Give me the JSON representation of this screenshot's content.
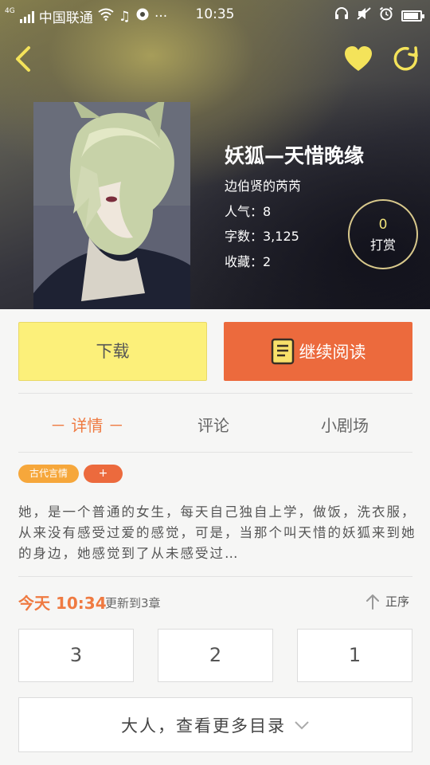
{
  "status_bar": {
    "network": "4G",
    "carrier": "中国联通",
    "time": "10:35"
  },
  "nav": {
    "back_icon": "chevron-left-icon",
    "favorite_icon": "heart-icon",
    "share_icon": "refresh-icon"
  },
  "book": {
    "title": "妖狐—天惜晚缘",
    "author": "边伯贤的芮芮",
    "popularity": "人气：8",
    "word_count": "字数：3,125",
    "favorites": "收藏：2"
  },
  "reward": {
    "count": "0",
    "label": "打赏"
  },
  "actions": {
    "download": "下载",
    "continue_reading": "继续阅读"
  },
  "tabs": [
    {
      "label": "－ 详情 －",
      "active": true
    },
    {
      "label": "评论",
      "active": false
    },
    {
      "label": "小剧场",
      "active": false
    }
  ],
  "tags": {
    "genre": "古代言情",
    "add": "+"
  },
  "synopsis": "她，是一个普通的女生，每天自己独自上学，做饭，洗衣服，从来没有感受过爱的感觉，可是，当那个叫天惜的妖狐来到她的身边，她感觉到了从未感受过…",
  "update": {
    "time": "今天 10:34",
    "text": "更新到3章",
    "order_label": "正序"
  },
  "chapters": [
    "3",
    "2",
    "1"
  ],
  "more_catalog": "大人，查看更多目录",
  "colors": {
    "accent": "#ec6a3d",
    "download_button": "#fcf07a",
    "tag": "#f6a73b",
    "heart": "#f4e35a"
  }
}
